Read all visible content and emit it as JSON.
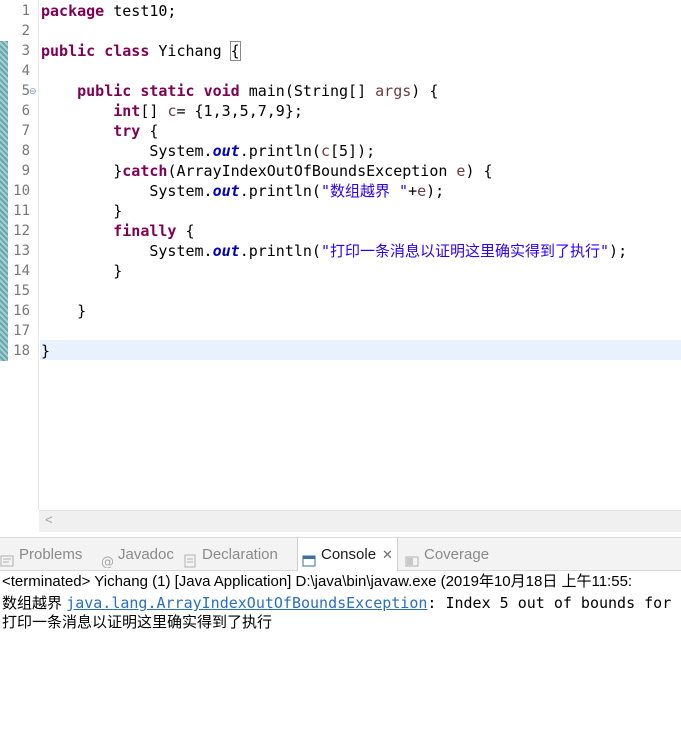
{
  "editor": {
    "line_numbers": [
      "1",
      "2",
      "3",
      "4",
      "5",
      "6",
      "7",
      "8",
      "9",
      "10",
      "11",
      "12",
      "13",
      "14",
      "15",
      "16",
      "17",
      "18"
    ],
    "lines": [
      {
        "tokens": [
          {
            "t": "package",
            "c": "kw"
          },
          {
            "t": " test10;"
          }
        ]
      },
      {
        "tokens": []
      },
      {
        "tokens": [
          {
            "t": "public",
            "c": "kw"
          },
          {
            "t": " "
          },
          {
            "t": "class",
            "c": "kw"
          },
          {
            "t": " Yichang "
          },
          {
            "t": "{",
            "c": "brace-box"
          }
        ]
      },
      {
        "tokens": []
      },
      {
        "tokens": [
          {
            "t": "    "
          },
          {
            "t": "public",
            "c": "kw"
          },
          {
            "t": " "
          },
          {
            "t": "static",
            "c": "kw"
          },
          {
            "t": " "
          },
          {
            "t": "void",
            "c": "kw"
          },
          {
            "t": " main(String[] "
          },
          {
            "t": "args",
            "c": "var"
          },
          {
            "t": ") {"
          }
        ]
      },
      {
        "tokens": [
          {
            "t": "        "
          },
          {
            "t": "int",
            "c": "kw"
          },
          {
            "t": "[] "
          },
          {
            "t": "c",
            "c": "var"
          },
          {
            "t": "= {1,3,5,7,9};"
          }
        ]
      },
      {
        "tokens": [
          {
            "t": "        "
          },
          {
            "t": "try",
            "c": "kw"
          },
          {
            "t": " {"
          }
        ]
      },
      {
        "tokens": [
          {
            "t": "            System."
          },
          {
            "t": "out",
            "c": "fld"
          },
          {
            "t": ".println("
          },
          {
            "t": "c",
            "c": "var"
          },
          {
            "t": "[5]);"
          }
        ]
      },
      {
        "tokens": [
          {
            "t": "        }"
          },
          {
            "t": "catch",
            "c": "kw"
          },
          {
            "t": "(ArrayIndexOutOfBoundsException "
          },
          {
            "t": "e",
            "c": "var"
          },
          {
            "t": ") {"
          }
        ]
      },
      {
        "tokens": [
          {
            "t": "            System."
          },
          {
            "t": "out",
            "c": "fld"
          },
          {
            "t": ".println("
          },
          {
            "t": "\"数组越界 \"",
            "c": "str"
          },
          {
            "t": "+"
          },
          {
            "t": "e",
            "c": "var"
          },
          {
            "t": ");"
          }
        ]
      },
      {
        "tokens": [
          {
            "t": "        }"
          }
        ]
      },
      {
        "tokens": [
          {
            "t": "        "
          },
          {
            "t": "finally",
            "c": "kw"
          },
          {
            "t": " {"
          }
        ]
      },
      {
        "tokens": [
          {
            "t": "            System."
          },
          {
            "t": "out",
            "c": "fld"
          },
          {
            "t": ".println("
          },
          {
            "t": "\"打印一条消息以证明这里确实得到了执行\"",
            "c": "str"
          },
          {
            "t": ");"
          }
        ]
      },
      {
        "tokens": [
          {
            "t": "        }"
          }
        ]
      },
      {
        "tokens": []
      },
      {
        "tokens": [
          {
            "t": "    }"
          }
        ]
      },
      {
        "tokens": []
      },
      {
        "tokens": [
          {
            "t": "}"
          }
        ]
      }
    ]
  },
  "tabs": [
    {
      "label": "Problems",
      "icon": "problems-icon",
      "active": false
    },
    {
      "label": "Javadoc",
      "icon": "javadoc-icon",
      "active": false
    },
    {
      "label": "Declaration",
      "icon": "declaration-icon",
      "active": false
    },
    {
      "label": "Console",
      "icon": "console-icon",
      "active": true,
      "close": "✕"
    },
    {
      "label": "Coverage",
      "icon": "coverage-icon",
      "active": false
    }
  ],
  "console": {
    "status": "<terminated> Yichang (1) [Java Application] D:\\java\\bin\\javaw.exe (2019年10月18日 上午11:55:",
    "out_prefix": "数组越界 ",
    "exception_link": "java.lang.ArrayIndexOutOfBoundsException",
    "exception_rest": ": Index 5 out of bounds for",
    "out_line2": "打印一条消息以证明这里确实得到了执行"
  },
  "colors": {
    "keyword": "#7f0055",
    "string": "#2a00ff",
    "static_field": "#0000c0",
    "link": "#2a6fbb",
    "current_line": "#e8f2fe"
  }
}
